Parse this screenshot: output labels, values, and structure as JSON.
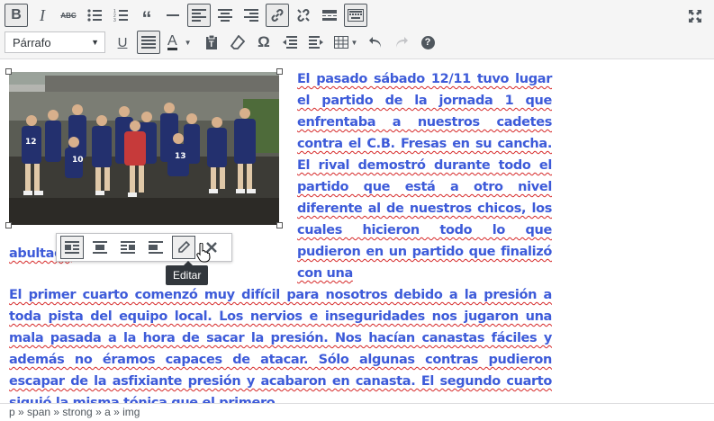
{
  "toolbar": {
    "row1": [
      {
        "name": "bold-button",
        "label": "B",
        "active": true
      },
      {
        "name": "italic-button",
        "label": "I",
        "active": false
      },
      {
        "name": "strikethrough-button",
        "label": "ABC",
        "active": false
      },
      {
        "name": "bulleted-list-button",
        "label": "",
        "active": false
      },
      {
        "name": "numbered-list-button",
        "label": "",
        "active": false
      },
      {
        "name": "blockquote-button",
        "label": "❝❝",
        "active": false
      },
      {
        "name": "horizontal-line-button",
        "label": "—",
        "active": false
      },
      {
        "name": "align-left-button",
        "label": "",
        "active": true
      },
      {
        "name": "align-center-button",
        "label": "",
        "active": false
      },
      {
        "name": "align-right-button",
        "label": "",
        "active": false
      },
      {
        "name": "insert-link-button",
        "label": "",
        "active": true
      },
      {
        "name": "remove-link-button",
        "label": "",
        "active": false
      },
      {
        "name": "read-more-button",
        "label": "",
        "active": false
      },
      {
        "name": "toolbar-toggle-button",
        "label": "",
        "active": true
      }
    ],
    "format_select": "Párrafo",
    "row2_labels": {
      "underline": "U",
      "text_color": "A",
      "special_char": "Ω",
      "help": "?"
    }
  },
  "content": {
    "p1_parts": [
      "El pasado sábado 12/11 tuvo lugar el partido de la jornada 1 que enfrentaba a nuestros cadetes contra el C.B. Fresas en su cancha. El rival demostró durante todo el partido que está a otro nivel diferente al de nuestros chicos, los cuales hicieron todo lo que pudieron en un partido que finalizó con una"
    ],
    "p1_tail": "abultado",
    "p2": "El primer cuarto comenzó muy difícil para nosotros debido a la presión a toda pista del equipo local. Los nervios e inseguridades nos jugaron una mala pasada a la hora de sacar la presión. Nos hacían canastas fáciles y además no éramos capaces de atacar. Sólo algunas contras pudieron escapar de la asfixiante presión y acabaron en canasta. El segundo cuarto siguió la misma tónica que el primero."
  },
  "image_toolbar": {
    "tooltip": "Editar"
  },
  "status_path": "p » span » strong » a » img",
  "colors": {
    "text": "#3d5bd9",
    "spell": "#d62828",
    "toolbar_bg": "#f5f5f5"
  }
}
